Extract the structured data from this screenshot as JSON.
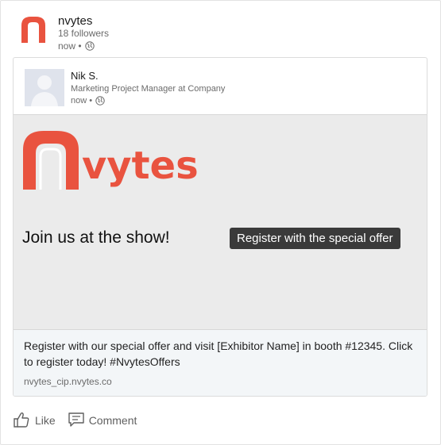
{
  "company": {
    "name": "nvytes",
    "followers": "18 followers",
    "time": "now •"
  },
  "shared_post": {
    "author": "Nik S.",
    "headline": "Marketing Project Manager at Company",
    "time": "now •",
    "banner": {
      "logo_text": "vytes",
      "tagline": "Join us at the show!",
      "cta": "Register with the special offer"
    },
    "description": "Register with our special offer and visit [Exhibitor Name] in booth #12345. Click to register today! #NvytesOffers",
    "domain": "nvytes_cip.nvytes.co"
  },
  "actions": {
    "like": "Like",
    "comment": "Comment"
  },
  "colors": {
    "brand_red": "#e9533f",
    "button_dark": "#3a3a3a"
  }
}
